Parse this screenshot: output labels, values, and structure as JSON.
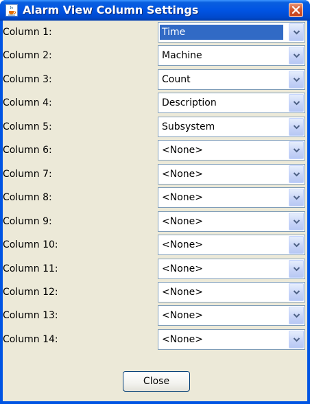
{
  "window": {
    "title": "Alarm View Column Settings",
    "icon": "java-cup-icon",
    "close_icon": "close-icon"
  },
  "columns": [
    {
      "label": "Column 1:",
      "value": "Time",
      "selected": true
    },
    {
      "label": "Column 2:",
      "value": "Machine",
      "selected": false
    },
    {
      "label": "Column 3:",
      "value": "Count",
      "selected": false
    },
    {
      "label": "Column 4:",
      "value": "Description",
      "selected": false
    },
    {
      "label": "Column 5:",
      "value": "Subsystem",
      "selected": false
    },
    {
      "label": "Column 6:",
      "value": "<None>",
      "selected": false
    },
    {
      "label": "Column 7:",
      "value": "<None>",
      "selected": false
    },
    {
      "label": "Column 8:",
      "value": "<None>",
      "selected": false
    },
    {
      "label": "Column 9:",
      "value": "<None>",
      "selected": false
    },
    {
      "label": "Column 10:",
      "value": "<None>",
      "selected": false
    },
    {
      "label": "Column 11:",
      "value": "<None>",
      "selected": false
    },
    {
      "label": "Column 12:",
      "value": "<None>",
      "selected": false
    },
    {
      "label": "Column 13:",
      "value": "<None>",
      "selected": false
    },
    {
      "label": "Column 14:",
      "value": "<None>",
      "selected": false
    }
  ],
  "footer": {
    "close_label": "Close"
  },
  "colors": {
    "titlebar": "#0054e3",
    "client_background": "#ece9d8",
    "selection": "#316ac5",
    "close_button": "#d5582e"
  }
}
